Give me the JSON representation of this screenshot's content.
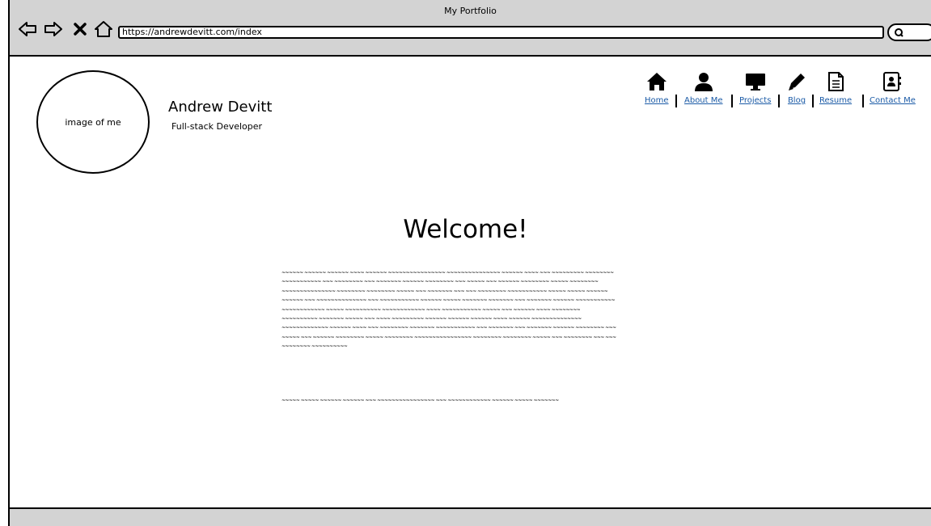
{
  "window": {
    "title": "My Portfolio"
  },
  "toolbar": {
    "url": "https://andrewdevitt.com/index",
    "buttons": [
      "back-icon",
      "forward-icon",
      "close-icon",
      "home-icon"
    ],
    "search_icon": "search-icon"
  },
  "header": {
    "avatar_label": "image of me",
    "name": "Andrew Devitt",
    "role": "Full-stack Developer"
  },
  "nav": {
    "items": [
      {
        "label": "Home",
        "icon": "home-icon"
      },
      {
        "label": "About Me",
        "icon": "user-icon"
      },
      {
        "label": "Projects",
        "icon": "monitor-icon"
      },
      {
        "label": "Blog",
        "icon": "pencil-icon"
      },
      {
        "label": "Resume",
        "icon": "document-icon"
      },
      {
        "label": "Contact Me",
        "icon": "contact-card-icon"
      }
    ],
    "link_color": "#1a5aa6"
  },
  "main": {
    "heading": "Welcome!",
    "paragraph_1": "~~~~~~ ~~~~~~ ~~~~~~ ~~~~ ~~~~~~ ~~~~~~~~~~~~~~~~ ~~~~~~~~~~~~~~~ ~~~~~~ ~~~~ ~~~ ~~~~~~~~~ ~~~~~~~~ ~~~~~~~~~~~ ~~~ ~~~~~~~~ ~~~ ~~~~~~~ ~~~~~~ ~~~~~~~~ ~~~ ~~~~~ ~~~ ~~~~~~ ~~~~~~~~ ~~~~~ ~~~~~~~~ ~~~~~~~~~~~~~~~ ~~~~~~~~ ~~~~~~~~ ~~~~~ ~~~ ~~~~~~~ ~~~ ~~~ ~~~~~~~~ ~~~~~~~~~~~ ~~~~~ ~~~~~ ~~~~~~ ~~~~~~ ~~~ ~~~~~~~~~~~~~~ ~~~ ~~~~~~~~~~~ ~~~~~~ ~~~~~ ~~~~~~~ ~~~~~~~ ~~~ ~~~~~~~ ~~~~~~ ~~~~~~~~~~~ ~~~~~~~~~~~~ ~~~~~ ~~~~~~~~~~ ~~~~~~~~~~~~ ~~~~ ~~~~~~~~~~~ ~~~~~ ~~~ ~~~~~~ ~~~~ ~~~~~~~~ ~~~~~~~~~~ ~~~~~~~ ~~~~~ ~~~ ~~~~ ~~~~~~~~~ ~~~~~~ ~~~~~~ ~~~~~~ ~~~~ ~~~~~~ ~~~~~~~~~~~~~~ ~~~~~~~~~~~~~ ~~~~~~ ~~~~ ~~~ ~~~~~~~~ ~~~~~~~ ~~~~~~~~~~~ ~~~ ~~~~~~~ ~~~ ~~~~~~~ ~~~~~~ ~~~~~~~~ ~~~ ~~~~~ ~~~ ~~~~~~ ~~~~~~~~ ~~~~~ ~~~~~~~~ ~~~~~~~~~~~~~~~~ ~~~~~~~~ ~~~~~~~~ ~~~~~ ~~~ ~~~~~~~~ ~~~ ~~~ ~~~~~~~~ ~~~~~~~~~~",
    "paragraph_2": "~~~~~ ~~~~~ ~~~~~~ ~~~~~~ ~~~ ~~~~~~~~~~~~~~~~ ~~~ ~~~~~~~~~~~~ ~~~~~~ ~~~~~ ~~~~~~~"
  }
}
